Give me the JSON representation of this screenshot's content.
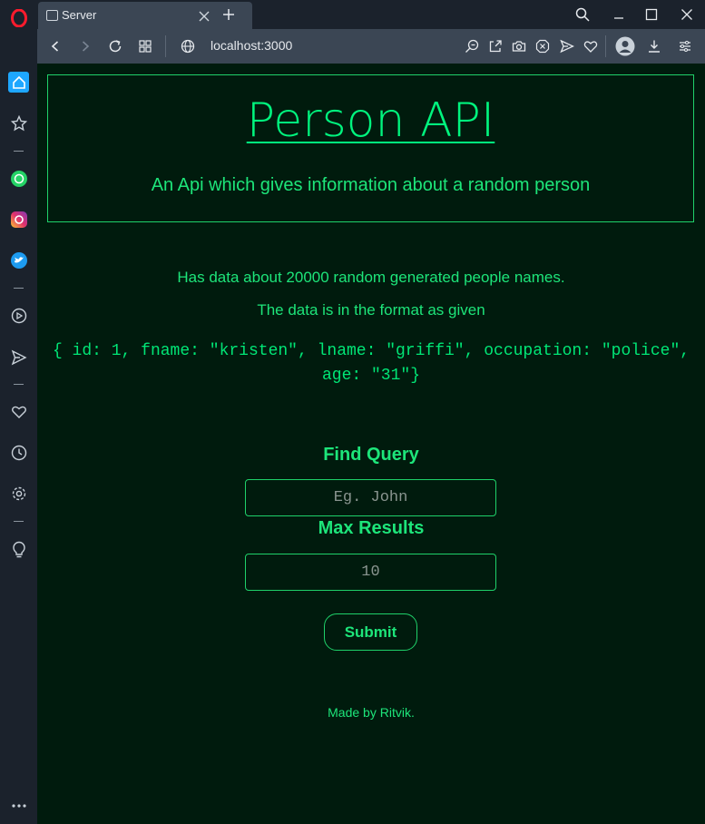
{
  "browser": {
    "tab_title": "Server",
    "url": "localhost:3000"
  },
  "sidebar": {
    "items": [
      "home-icon",
      "star-icon",
      "whatsapp-icon",
      "instagram-icon",
      "twitter-icon",
      "player-icon",
      "send-icon",
      "heart-icon",
      "history-icon",
      "settings-icon",
      "bulb-icon",
      "more-icon"
    ]
  },
  "page": {
    "title": "Person API",
    "subtitle": "An Api which gives information about a random person",
    "line1": "Has data about 20000 random generated people names.",
    "line2": "The data is in the format as given",
    "code_line1": "{ id: 1, fname: \"kristen\", lname: \"griffi\", occupation: \"police\",",
    "code_line2": "age: \"31\"}",
    "find_label": "Find Query",
    "find_placeholder": "Eg. John",
    "max_label": "Max Results",
    "max_placeholder": "10",
    "submit_label": "Submit",
    "footer": "Made by Ritvik."
  },
  "colors": {
    "accent": "#00e676",
    "page_bg": "#001b0d",
    "chrome_bg": "#1b222c"
  }
}
